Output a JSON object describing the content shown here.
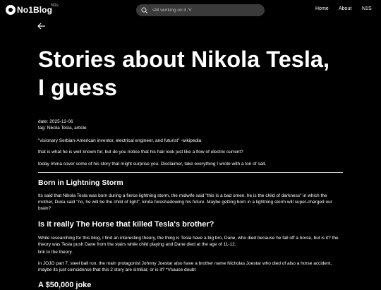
{
  "nav": {
    "logo_text": "No1Blog",
    "logo_sup": "N1s",
    "search_placeholder": "still working on it :V",
    "menu": [
      "Home",
      "About",
      "N1S"
    ]
  },
  "post": {
    "title_line1": "Stories about Nikola Tesla,",
    "title_line2": "I guess",
    "date": "date: 2025-12-06",
    "tags": "tag: Nikola Tesla, article",
    "intro": [
      "\"visionary Serbian-American inventor, electrical engineer, and futurist\" -wikipedia",
      "that is what he is well known for, but do you notice that his hair look just like a flow of electric current?",
      "today Imma cover some of his story that might surprise you. Disclaimer, take everything I wrote with a ton of salt."
    ],
    "sections": [
      {
        "heading": "Born in Lightning Storm",
        "paragraphs": [
          "Its said that Nikola Tesla was born during a fierce lightning storm, the midwife said \"this is a bad omen, he is the child of darkness\" in which the mother, Duka said \"no, he will be the child of light\", kinda foreshadowing his future. Maybe getting born in a lightning storm will super-charged our brain?"
        ]
      },
      {
        "heading": "Is it really The Horse that killed Tesla's brother?",
        "paragraphs": [
          "While researching for this blog, I find an interesting theory, the thing is Tesla have a big bro, Dane, who died because he fall off a horse, but is it? the theory was Tesla push Dane from the stairs while child playing and Dane died at the age of 11-12.",
          "link to the theory.",
          "in JOJO part 7, steel ball run, the main protagonist Johnny Joestar also have a brother name Nicholas Joestar who died of also a horse accident, maybe its just coincidence that this 2 story are similiar, or is it? *Vsauce doubt"
        ]
      },
      {
        "heading": "A $50,000 joke"
      }
    ]
  }
}
